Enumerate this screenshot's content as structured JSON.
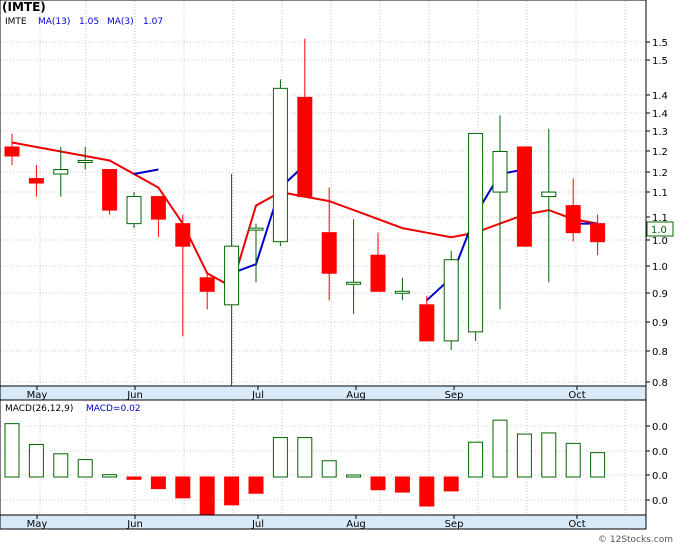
{
  "ticker_label": "(IMTE)",
  "legend": {
    "symbol": "IMTE",
    "ma13": "MA(13)",
    "ma13_value": "1.05",
    "ma3": "MA(3)",
    "ma3_value": "1.07"
  },
  "macd_legend": {
    "name": "MACD(26,12,9)",
    "value_label": "MACD=0.02"
  },
  "last_price_label": "1.0",
  "watermark": "© 12Stocks.com",
  "colors": {
    "up": "#006600",
    "down": "#ff0000",
    "ma13": "#0000cc",
    "ma3": "#ee0000",
    "axis_bg": "#d8eaf8",
    "grid": "#999999"
  },
  "chart_data": [
    {
      "type": "candlestick",
      "x_labels": [
        "May",
        "Jun",
        "Jul",
        "Aug",
        "Sep",
        "Oct"
      ],
      "y_tick_labels": [
        "1.5",
        "1.5",
        "1.4",
        "1.4",
        "1.3",
        "1.2",
        "1.2",
        "1.1",
        "1.1",
        "1.0",
        "1.0",
        "0.9",
        "0.9",
        "0.8",
        "0.8"
      ],
      "grid": true,
      "candles": [
        {
          "o": 1.29,
          "h": 1.32,
          "l": 1.25,
          "c": 1.27
        },
        {
          "o": 1.22,
          "h": 1.25,
          "l": 1.18,
          "c": 1.21
        },
        {
          "o": 1.23,
          "h": 1.29,
          "l": 1.18,
          "c": 1.24
        },
        {
          "o": 1.26,
          "h": 1.29,
          "l": 1.24,
          "c": 1.26
        },
        {
          "o": 1.24,
          "h": 1.24,
          "l": 1.14,
          "c": 1.15
        },
        {
          "o": 1.12,
          "h": 1.19,
          "l": 1.11,
          "c": 1.18
        },
        {
          "o": 1.18,
          "h": 1.18,
          "l": 1.09,
          "c": 1.13
        },
        {
          "o": 1.12,
          "h": 1.14,
          "l": 0.87,
          "c": 1.07
        },
        {
          "o": 1.0,
          "h": 1.01,
          "l": 0.93,
          "c": 0.97
        },
        {
          "o": 0.94,
          "h": 1.23,
          "l": 0.76,
          "c": 1.07
        },
        {
          "o": 1.11,
          "h": 1.12,
          "l": 0.99,
          "c": 1.11
        },
        {
          "o": 1.08,
          "h": 1.44,
          "l": 1.07,
          "c": 1.42
        },
        {
          "o": 1.4,
          "h": 1.53,
          "l": 1.18,
          "c": 1.18
        },
        {
          "o": 1.1,
          "h": 1.2,
          "l": 0.95,
          "c": 1.01
        },
        {
          "o": 0.99,
          "h": 1.13,
          "l": 0.92,
          "c": 0.99
        },
        {
          "o": 1.05,
          "h": 1.1,
          "l": 0.97,
          "c": 0.97
        },
        {
          "o": 0.97,
          "h": 1.0,
          "l": 0.95,
          "c": 0.97
        },
        {
          "o": 0.94,
          "h": 0.96,
          "l": 0.86,
          "c": 0.86
        },
        {
          "o": 0.86,
          "h": 1.06,
          "l": 0.84,
          "c": 1.04
        },
        {
          "o": 0.88,
          "h": 1.32,
          "l": 0.86,
          "c": 1.32
        },
        {
          "o": 1.19,
          "h": 1.36,
          "l": 0.93,
          "c": 1.28
        },
        {
          "o": 1.29,
          "h": 1.29,
          "l": 1.07,
          "c": 1.07
        },
        {
          "o": 1.18,
          "h": 1.33,
          "l": 0.99,
          "c": 1.19
        },
        {
          "o": 1.16,
          "h": 1.22,
          "l": 1.08,
          "c": 1.1
        },
        {
          "o": 1.12,
          "h": 1.14,
          "l": 1.05,
          "c": 1.08
        }
      ],
      "ma3": [
        1.3,
        1.29,
        1.28,
        1.27,
        1.26,
        1.23,
        1.2,
        1.12,
        1.01,
        0.98,
        1.16,
        1.19,
        1.18,
        1.17,
        1.15,
        1.13,
        1.11,
        1.1,
        1.09,
        1.1,
        1.12,
        1.14,
        1.15,
        1.13,
        1.12
      ],
      "ma13": [
        null,
        null,
        null,
        null,
        null,
        1.23,
        1.24,
        null,
        null,
        1.01,
        1.03,
        1.2,
        1.25,
        null,
        null,
        null,
        null,
        0.95,
        1.0,
        1.14,
        1.23,
        1.24,
        null,
        1.12,
        1.12
      ]
    },
    {
      "type": "bar",
      "title": "MACD(26,12,9)",
      "x_labels": [
        "May",
        "Jun",
        "Jul",
        "Aug",
        "Sep",
        "Oct"
      ],
      "y_tick_labels": [
        "0.0",
        "0.0",
        "0.0",
        "0.0"
      ],
      "values": [
        0.046,
        0.028,
        0.02,
        0.015,
        0.002,
        -0.002,
        -0.01,
        -0.018,
        -0.032,
        -0.024,
        -0.014,
        0.034,
        0.034,
        0.014,
        0.001,
        -0.011,
        -0.013,
        -0.025,
        -0.012,
        0.03,
        0.049,
        0.037,
        0.038,
        0.029,
        0.021
      ]
    }
  ]
}
